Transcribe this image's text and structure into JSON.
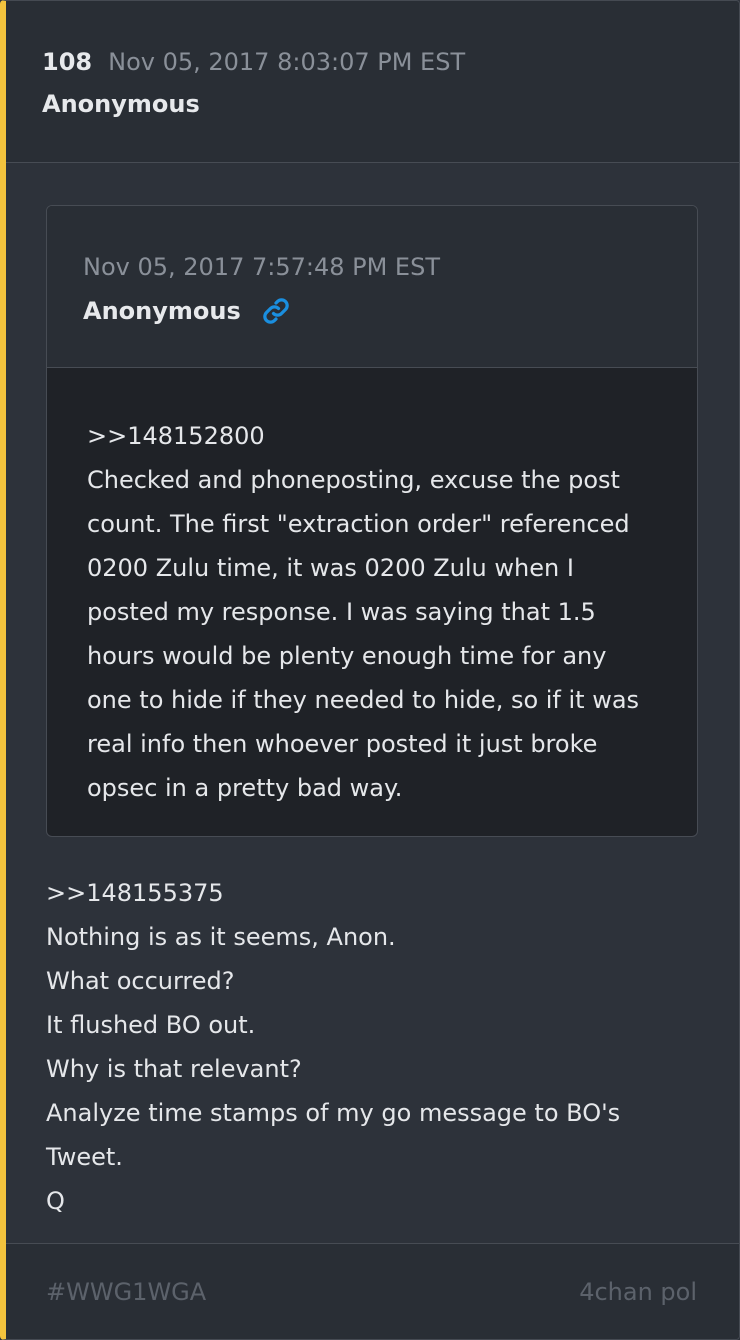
{
  "post": {
    "number": "108",
    "timestamp": "Nov 05, 2017 8:03:07 PM EST",
    "author": "Anonymous"
  },
  "quoted": {
    "timestamp": "Nov 05, 2017 7:57:48 PM EST",
    "author": "Anonymous",
    "link_icon": "link-icon",
    "lines": [
      ">>148152800",
      "Checked and phoneposting, excuse the post count. The first \"extraction order\" referenced 0200 Zulu time, it was 0200 Zulu when I posted my response. I was saying that 1.5 hours would be plenty enough time for any one to hide if they needed to hide, so if it was real info then whoever posted it just broke opsec in a pretty bad way."
    ]
  },
  "message": {
    "lines": [
      ">>148155375",
      "Nothing is as it seems, Anon.",
      "What occurred?",
      "It flushed BO out.",
      "Why is that relevant?",
      "Analyze time stamps of my go message to BO's Tweet.",
      "Q"
    ]
  },
  "footer": {
    "tag": "#WWG1WGA",
    "source": "4chan pol"
  },
  "colors": {
    "accent_bar": "#f3c33d",
    "link": "#1a8fe0"
  }
}
